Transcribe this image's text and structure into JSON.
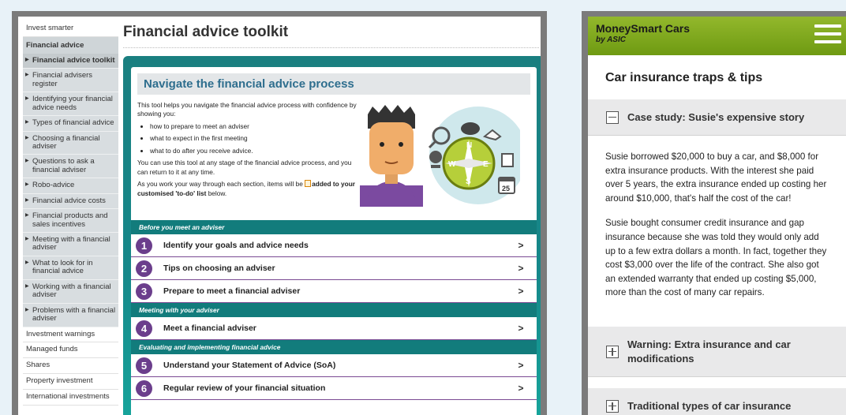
{
  "desktop": {
    "sidebar": {
      "top_link": "Invest smarter",
      "section_title": "Financial advice",
      "items": [
        "Financial advice toolkit",
        "Financial advisers register",
        "Identifying your financial advice needs",
        "Types of financial advice",
        "Choosing a financial adviser",
        "Questions to ask a financial adviser",
        "Robo-advice",
        "Financial advice costs",
        "Financial products and sales incentives",
        "Meeting with a financial adviser",
        "What to look for in financial advice",
        "Working with a financial adviser",
        "Problems with a financial adviser"
      ],
      "bottom_links": [
        "Investment warnings",
        "Managed funds",
        "Shares",
        "Property investment",
        "International investments"
      ]
    },
    "page_title": "Financial advice toolkit",
    "intro": {
      "heading": "Navigate the financial advice process",
      "lead": "This tool helps you navigate the financial advice process with confidence by showing you:",
      "bullets": [
        "how to prepare to meet an adviser",
        "what to expect in the first meeting",
        "what to do after you receive advice."
      ],
      "para": "You can use this tool at any stage of the financial advice process, and you can return to it at any time.",
      "para2_start": "As you work your way through each section, items will be ",
      "para2_bold": "added to your customised 'to-do' list",
      "para2_end": " below.",
      "calendar_day": "25"
    },
    "sections": [
      {
        "band": "Before you meet an adviser",
        "steps": [
          {
            "num": "1",
            "label": "Identify your goals and advice needs"
          },
          {
            "num": "2",
            "label": "Tips on choosing an adviser"
          },
          {
            "num": "3",
            "label": "Prepare to meet a financial adviser"
          }
        ]
      },
      {
        "band": "Meeting with your adviser",
        "steps": [
          {
            "num": "4",
            "label": "Meet a financial adviser"
          }
        ]
      },
      {
        "band": "Evaluating and implementing financial advice",
        "steps": [
          {
            "num": "5",
            "label": "Understand your Statement of Advice (SoA)"
          },
          {
            "num": "6",
            "label": "Regular review of your financial situation"
          }
        ]
      }
    ],
    "step_arrow": ">"
  },
  "mobile": {
    "app_name": "MoneySmart Cars",
    "by_line": "by ASIC",
    "page_title": "Car insurance traps & tips",
    "accordions": [
      {
        "title": "Case study: Susie's expensive story",
        "expanded": true,
        "paragraphs": [
          "Susie borrowed $20,000 to buy a car, and $8,000 for extra insurance products. With the interest she paid over 5 years, the extra insurance ended up costing her around $10,000, that's half the cost of the car!",
          "Susie bought consumer credit insurance and gap insurance because she was told they would only add up to a few extra dollars a month. In fact, together they cost $3,000 over the life of the contract. She also got an extended warranty that ended up costing $5,000, more than the cost of many car repairs."
        ]
      },
      {
        "title": "Warning: Extra insurance and car modifications",
        "expanded": false
      },
      {
        "title": "Traditional types of car insurance",
        "expanded": false
      }
    ]
  },
  "colors": {
    "teal": "#16888a",
    "purple": "#6b3e8c",
    "green_header": "#7fa81e",
    "title_blue": "#2e6e8e"
  }
}
